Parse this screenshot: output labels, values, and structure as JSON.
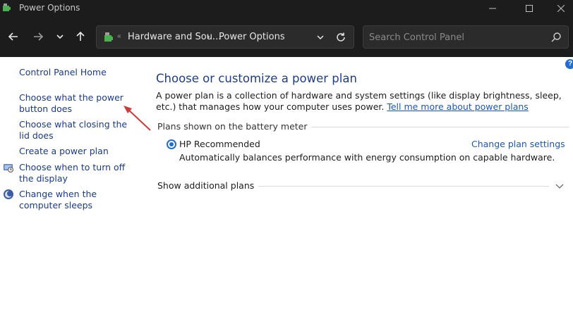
{
  "window": {
    "title": "Power Options"
  },
  "address_bar": {
    "crumbs": [
      "Hardware and Sou...",
      "Power Options"
    ]
  },
  "search": {
    "placeholder": "Search Control Panel"
  },
  "sidebar": {
    "items": [
      {
        "label": "Control Panel Home"
      },
      {
        "label": "Choose what the power button does"
      },
      {
        "label": "Choose what closing the lid does"
      },
      {
        "label": "Create a power plan"
      },
      {
        "label": "Choose when to turn off the display"
      },
      {
        "label": "Change when the computer sleeps"
      }
    ]
  },
  "main": {
    "title": "Choose or customize a power plan",
    "description": "A power plan is a collection of hardware and system settings (like display brightness, sleep, etc.) that manages how your computer uses power.",
    "learn_more": "Tell me more about power plans",
    "group_label": "Plans shown on the battery meter",
    "plan": {
      "name": "HP Recommended",
      "selected": true,
      "change_link": "Change plan settings",
      "description": "Automatically balances performance with energy consumption on capable hardware."
    },
    "show_additional": "Show additional plans"
  },
  "colors": {
    "titlebar_bg": "#1c1c1c",
    "link": "#1a3a8f",
    "accent": "#1f6fd1",
    "annotation_arrow": "#d03a3a"
  },
  "icons": {
    "app": "power-options-icon",
    "back": "arrow-left-icon",
    "forward": "arrow-right-icon",
    "recent": "chevron-down-icon",
    "up": "arrow-up-icon",
    "refresh": "refresh-icon",
    "search": "search-icon",
    "help": "help-icon"
  }
}
